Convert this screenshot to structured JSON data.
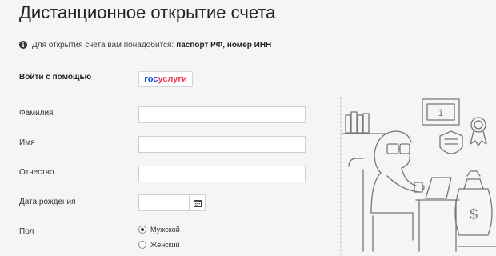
{
  "page": {
    "title": "Дистанционное открытие счета",
    "notice_prefix": "Для открытия счета вам понадобится:",
    "notice_bold": "паспорт РФ, номер ИНН"
  },
  "login": {
    "label": "Войти с помощью",
    "gosuslugi_part1": "гос",
    "gosuslugi_part2": "услуги"
  },
  "form": {
    "lastname_label": "Фамилия",
    "lastname_value": "",
    "firstname_label": "Имя",
    "firstname_value": "",
    "patronymic_label": "Отчество",
    "patronymic_value": "",
    "birthdate_label": "Дата рождения",
    "birthdate_value": "",
    "gender_label": "Пол",
    "gender_options": [
      "Мужской",
      "Женский"
    ],
    "gender_selected": "Мужской"
  },
  "illustration": {
    "plaque_number": "1",
    "money_symbol": "$"
  },
  "icons": {
    "info": "info-icon",
    "calendar": "calendar-icon"
  },
  "colors": {
    "gosuslugi_blue": "#0d4cd3",
    "gosuslugi_red": "#ee3f58",
    "background": "#f5f5f5"
  }
}
